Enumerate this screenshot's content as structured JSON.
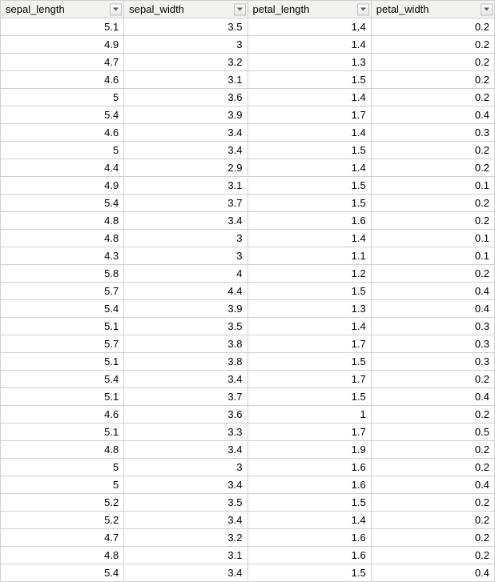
{
  "columns": [
    {
      "name": "sepal_length"
    },
    {
      "name": "sepal_width"
    },
    {
      "name": "petal_length"
    },
    {
      "name": "petal_width"
    }
  ],
  "rows": [
    [
      "5.1",
      "3.5",
      "1.4",
      "0.2"
    ],
    [
      "4.9",
      "3",
      "1.4",
      "0.2"
    ],
    [
      "4.7",
      "3.2",
      "1.3",
      "0.2"
    ],
    [
      "4.6",
      "3.1",
      "1.5",
      "0.2"
    ],
    [
      "5",
      "3.6",
      "1.4",
      "0.2"
    ],
    [
      "5.4",
      "3.9",
      "1.7",
      "0.4"
    ],
    [
      "4.6",
      "3.4",
      "1.4",
      "0.3"
    ],
    [
      "5",
      "3.4",
      "1.5",
      "0.2"
    ],
    [
      "4.4",
      "2.9",
      "1.4",
      "0.2"
    ],
    [
      "4.9",
      "3.1",
      "1.5",
      "0.1"
    ],
    [
      "5.4",
      "3.7",
      "1.5",
      "0.2"
    ],
    [
      "4.8",
      "3.4",
      "1.6",
      "0.2"
    ],
    [
      "4.8",
      "3",
      "1.4",
      "0.1"
    ],
    [
      "4.3",
      "3",
      "1.1",
      "0.1"
    ],
    [
      "5.8",
      "4",
      "1.2",
      "0.2"
    ],
    [
      "5.7",
      "4.4",
      "1.5",
      "0.4"
    ],
    [
      "5.4",
      "3.9",
      "1.3",
      "0.4"
    ],
    [
      "5.1",
      "3.5",
      "1.4",
      "0.3"
    ],
    [
      "5.7",
      "3.8",
      "1.7",
      "0.3"
    ],
    [
      "5.1",
      "3.8",
      "1.5",
      "0.3"
    ],
    [
      "5.4",
      "3.4",
      "1.7",
      "0.2"
    ],
    [
      "5.1",
      "3.7",
      "1.5",
      "0.4"
    ],
    [
      "4.6",
      "3.6",
      "1",
      "0.2"
    ],
    [
      "5.1",
      "3.3",
      "1.7",
      "0.5"
    ],
    [
      "4.8",
      "3.4",
      "1.9",
      "0.2"
    ],
    [
      "5",
      "3",
      "1.6",
      "0.2"
    ],
    [
      "5",
      "3.4",
      "1.6",
      "0.4"
    ],
    [
      "5.2",
      "3.5",
      "1.5",
      "0.2"
    ],
    [
      "5.2",
      "3.4",
      "1.4",
      "0.2"
    ],
    [
      "4.7",
      "3.2",
      "1.6",
      "0.2"
    ],
    [
      "4.8",
      "3.1",
      "1.6",
      "0.2"
    ],
    [
      "5.4",
      "3.4",
      "1.5",
      "0.4"
    ]
  ]
}
